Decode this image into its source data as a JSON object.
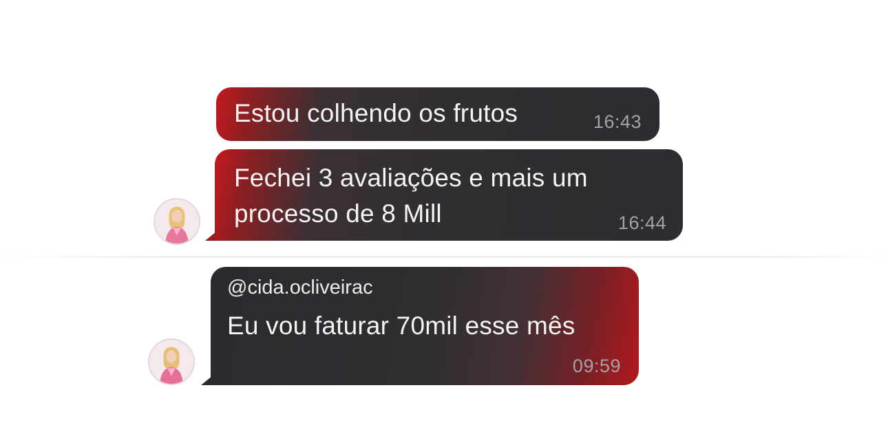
{
  "messages": [
    {
      "text": "Estou colhendo os frutos",
      "time": "16:43"
    },
    {
      "text": "Fechei 3 avaliações e mais um processo de 8 Mill",
      "time": "16:44"
    },
    {
      "sender": "@cida.ocliveirac",
      "text": "Eu vou faturar 70mil esse mês",
      "time": "09:59"
    }
  ],
  "avatars": [
    "user-avatar",
    "user-avatar"
  ],
  "colors": {
    "bubble_dark": "#2f2e31",
    "bubble_red": "#c41a1e",
    "time_gray": "#a3a3a6",
    "text_light": "#f4f4f4"
  }
}
